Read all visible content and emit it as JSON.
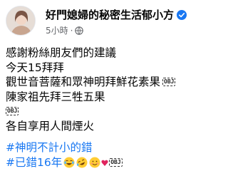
{
  "post": {
    "author": "好門媳婦的秘密生活郁小方",
    "time": "5小時",
    "separator": "·",
    "lines": [
      "感謝粉絲朋友們的建議",
      "今天15拜拜",
      "觀世音菩薩和眾神明拜鮮花素果",
      "陳家祖先拜三牲五果",
      "",
      "各自享用人間煙火"
    ],
    "obj_tag": "OBJ",
    "hashtags": [
      "#神明不計小的錯",
      "#已錯16年"
    ]
  },
  "icons": {
    "verified": "verified-badge-icon",
    "audience": "globe-icon",
    "emoji_1": "laughing-tears-emoji",
    "emoji_2": "rolling-laughing-emoji",
    "emoji_3": "hearts-face-emoji",
    "emoji_4": "red-heart-emoji"
  },
  "colors": {
    "accent": "#1877f2",
    "secondary_text": "#65676b"
  }
}
